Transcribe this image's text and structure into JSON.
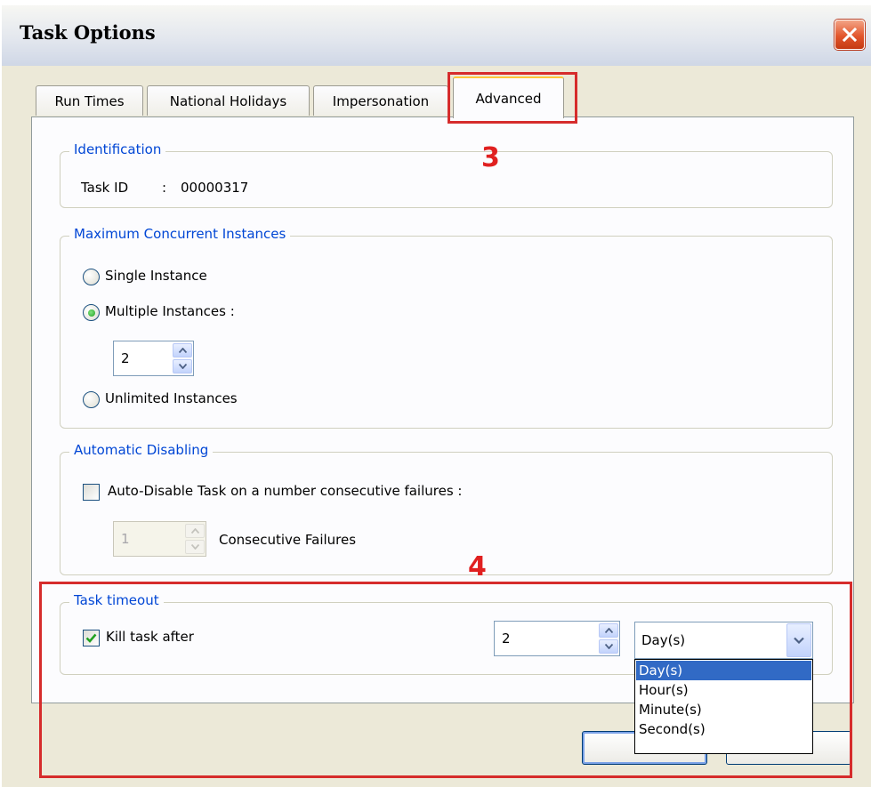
{
  "window": {
    "title": "Task Options"
  },
  "tabs": [
    {
      "label": "Run Times"
    },
    {
      "label": "National Holidays"
    },
    {
      "label": "Impersonation"
    },
    {
      "label": "Advanced"
    }
  ],
  "identification": {
    "title": "Identification",
    "task_id_label": "Task ID",
    "separator": ":",
    "task_id_value": "00000317"
  },
  "max_instances": {
    "title": "Maximum Concurrent Instances",
    "options": [
      {
        "label": "Single Instance",
        "selected": false
      },
      {
        "label": "Multiple Instances :",
        "selected": true
      },
      {
        "label": "Unlimited Instances",
        "selected": false
      }
    ],
    "multiple_value": "2"
  },
  "auto_disable": {
    "title": "Automatic Disabling",
    "checkbox_label": "Auto-Disable Task on a number consecutive failures :",
    "checked": false,
    "failures_value": "1",
    "failures_label": "Consecutive Failures"
  },
  "task_timeout": {
    "title": "Task timeout",
    "checkbox_label": "Kill task after",
    "checked": true,
    "value": "2",
    "unit_selected": "Day(s)",
    "unit_options": [
      "Day(s)",
      "Hour(s)",
      "Minute(s)",
      "Second(s)"
    ]
  },
  "annotations": [
    {
      "label": "3"
    },
    {
      "label": "4"
    }
  ],
  "colors": {
    "annotation": "#d62c2c",
    "group_title": "#0046d5",
    "selection": "#316ac5",
    "dialog_bg": "#ece9d8"
  },
  "icons": [
    "close-icon",
    "spin-up-icon",
    "spin-down-icon",
    "dropdown-arrow-icon",
    "checkmark-icon"
  ]
}
